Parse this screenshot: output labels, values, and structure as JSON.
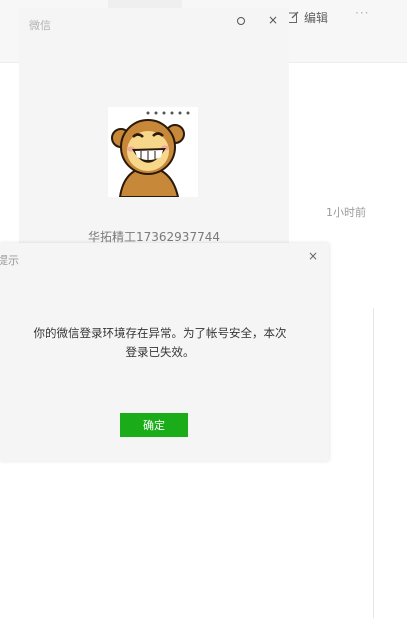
{
  "background": {
    "edit_label": "编辑",
    "more_label": "···",
    "timestamp": "1小时前"
  },
  "wechat_window": {
    "title": "微信",
    "close_glyph": "×",
    "account_name": "华拓精工17362937744",
    "avatar_icon": "grinning-monkey-avatar"
  },
  "alert": {
    "title": "提示",
    "close_glyph": "×",
    "message_line1": "你的微信登录环境存在异常。为了帐号安全，本次",
    "message_line2": "登录已失效。",
    "ok_label": "确定",
    "ok_color": "#1aad19"
  }
}
